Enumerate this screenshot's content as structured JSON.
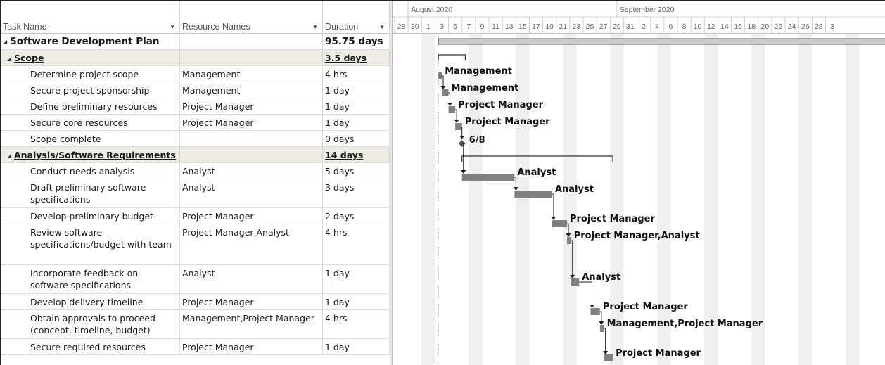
{
  "columns": {
    "task_name": "Task Name",
    "resource_names": "Resource Names",
    "duration": "Duration"
  },
  "timeline": {
    "months": [
      {
        "label": "August 2020",
        "day_index": 2
      },
      {
        "label": "September 2020",
        "day_index": 33
      }
    ],
    "days": [
      "28",
      "30",
      "1",
      "3",
      "5",
      "7",
      "9",
      "11",
      "13",
      "15",
      "17",
      "19",
      "21",
      "23",
      "25",
      "27",
      "29",
      "31",
      "2",
      "4",
      "6",
      "8",
      "10",
      "12",
      "14",
      "16",
      "18",
      "20",
      "22",
      "24",
      "26",
      "28",
      "3"
    ]
  },
  "tasks": [
    {
      "name": "Software Development Plan",
      "resources": "",
      "duration": "95.75 days",
      "level": 0,
      "type": "project",
      "lines": 1
    },
    {
      "name": "Scope",
      "resources": "",
      "duration": "3.5 days",
      "level": 1,
      "type": "summary",
      "lines": 1
    },
    {
      "name": "Determine project scope",
      "resources": "Management",
      "duration": "4 hrs",
      "level": 2,
      "type": "task",
      "lines": 1
    },
    {
      "name": "Secure project sponsorship",
      "resources": "Management",
      "duration": "1 day",
      "level": 2,
      "type": "task",
      "lines": 1
    },
    {
      "name": "Define preliminary resources",
      "resources": "Project Manager",
      "duration": "1 day",
      "level": 2,
      "type": "task",
      "lines": 1
    },
    {
      "name": "Secure core resources",
      "resources": "Project Manager",
      "duration": "1 day",
      "level": 2,
      "type": "task",
      "lines": 1
    },
    {
      "name": "Scope complete",
      "resources": "",
      "duration": "0 days",
      "level": 2,
      "type": "milestone",
      "lines": 1
    },
    {
      "name": "Analysis/Software Requirements",
      "resources": "",
      "duration": "14 days",
      "level": 1,
      "type": "summary",
      "lines": 1
    },
    {
      "name": "Conduct needs analysis",
      "resources": "Analyst",
      "duration": "5 days",
      "level": 2,
      "type": "task",
      "lines": 1
    },
    {
      "name": "Draft preliminary software specifications",
      "resources": "Analyst",
      "duration": "3 days",
      "level": 2,
      "type": "task",
      "lines": 2
    },
    {
      "name": "Develop preliminary budget",
      "resources": "Project Manager",
      "duration": "2 days",
      "level": 2,
      "type": "task",
      "lines": 1
    },
    {
      "name": "Review software specifications/budget with team",
      "resources": "Project Manager,Analyst",
      "duration": "4 hrs",
      "level": 2,
      "type": "task",
      "lines": 3
    },
    {
      "name": "Incorporate feedback on software specifications",
      "resources": "Analyst",
      "duration": "1 day",
      "level": 2,
      "type": "task",
      "lines": 2
    },
    {
      "name": "Develop delivery timeline",
      "resources": "Project Manager",
      "duration": "1 day",
      "level": 2,
      "type": "task",
      "lines": 1
    },
    {
      "name": "Obtain approvals to proceed (concept, timeline, budget)",
      "resources": "Management,Project Manager",
      "duration": "4 hrs",
      "level": 2,
      "type": "task",
      "lines": 2
    },
    {
      "name": "Secure required resources",
      "resources": "Project Manager",
      "duration": "1 day",
      "level": 2,
      "type": "task",
      "lines": 1
    }
  ],
  "gantt_labels": {
    "milestone_scope_complete": "6/8"
  },
  "colors": {
    "bar": "#808080",
    "summary_row": "#efede3",
    "weekend_shade": "#efefef",
    "link": "#222222"
  },
  "icons": {
    "collapse": "collapse-triangle-icon",
    "column_filter": "dropdown-arrow-icon"
  }
}
